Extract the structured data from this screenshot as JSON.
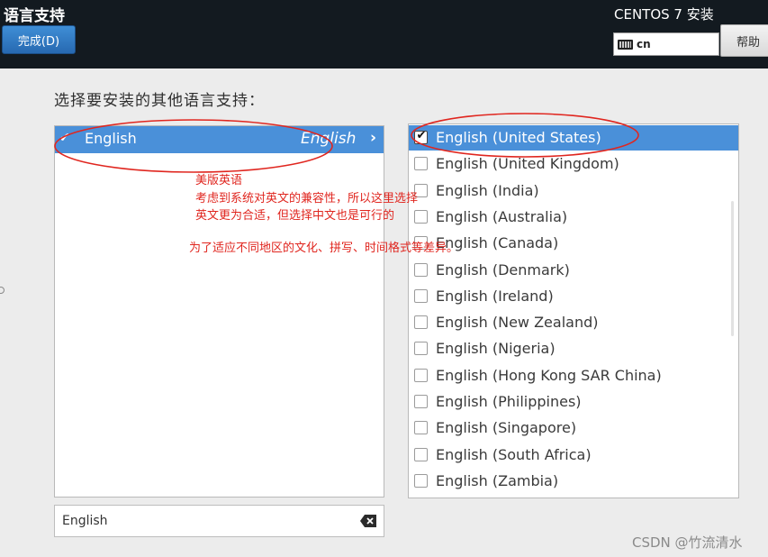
{
  "header": {
    "title": "语言支持",
    "done_button": "完成(D)",
    "os_title": "CENTOS 7 安装",
    "keyboard_layout": "cn",
    "help_button": "帮助"
  },
  "prompt": "选择要安装的其他语言支持：",
  "languages": [
    {
      "name": "English",
      "native": "English",
      "checked": true
    }
  ],
  "locales": [
    {
      "label": "English (United States)",
      "checked": true
    },
    {
      "label": "English (United Kingdom)",
      "checked": false
    },
    {
      "label": "English (India)",
      "checked": false
    },
    {
      "label": "English (Australia)",
      "checked": false
    },
    {
      "label": "English (Canada)",
      "checked": false
    },
    {
      "label": "English (Denmark)",
      "checked": false
    },
    {
      "label": "English (Ireland)",
      "checked": false
    },
    {
      "label": "English (New Zealand)",
      "checked": false
    },
    {
      "label": "English (Nigeria)",
      "checked": false
    },
    {
      "label": "English (Hong Kong SAR China)",
      "checked": false
    },
    {
      "label": "English (Philippines)",
      "checked": false
    },
    {
      "label": "English (Singapore)",
      "checked": false
    },
    {
      "label": "English (South Africa)",
      "checked": false
    },
    {
      "label": "English (Zambia)",
      "checked": false
    }
  ],
  "search": {
    "value": "English"
  },
  "annotations": {
    "line1": "美版英语",
    "line2": "考虑到系统对英文的兼容性，所以这里选择",
    "line3": "英文更为合适，但选择中文也是可行的",
    "line4": "为了适应不同地区的文化、拼写、时间格式等差异。"
  },
  "watermark": "CSDN @竹流清水",
  "colors": {
    "header_bg": "#131a20",
    "selection": "#4a90d9",
    "annotation": "#e0261f",
    "done_button": "#3a86d0"
  },
  "icons": [
    "keyboard-icon",
    "checkmark-icon",
    "chevron-right-icon",
    "clear-backspace-icon"
  ]
}
